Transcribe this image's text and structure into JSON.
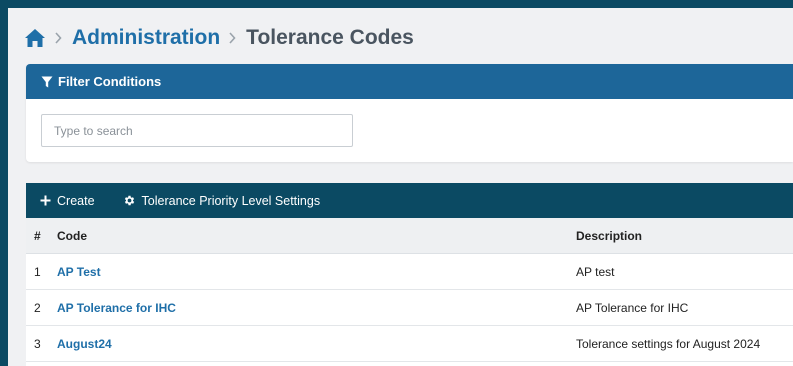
{
  "breadcrumb": {
    "home_icon": "home-icon",
    "parent": "Administration",
    "current": "Tolerance Codes"
  },
  "filter": {
    "title": "Filter Conditions",
    "icon": "filter-icon",
    "search_placeholder": "Type to search",
    "search_value": ""
  },
  "toolbar": {
    "create_label": "Create",
    "create_icon": "plus-icon",
    "settings_label": "Tolerance Priority Level Settings",
    "settings_icon": "gear-icon"
  },
  "table": {
    "headers": {
      "num": "#",
      "code": "Code",
      "description": "Description"
    },
    "rows": [
      {
        "num": "1",
        "code": "AP Test",
        "description": "AP test"
      },
      {
        "num": "2",
        "code": "AP Tolerance for IHC",
        "description": "AP Tolerance for IHC"
      },
      {
        "num": "3",
        "code": "August24",
        "description": "Tolerance settings for August 2024"
      }
    ]
  },
  "colors": {
    "frame": "#0b4a63",
    "filter_header": "#1d6699",
    "link": "#1f6fa8",
    "background": "#f0f1f3"
  }
}
